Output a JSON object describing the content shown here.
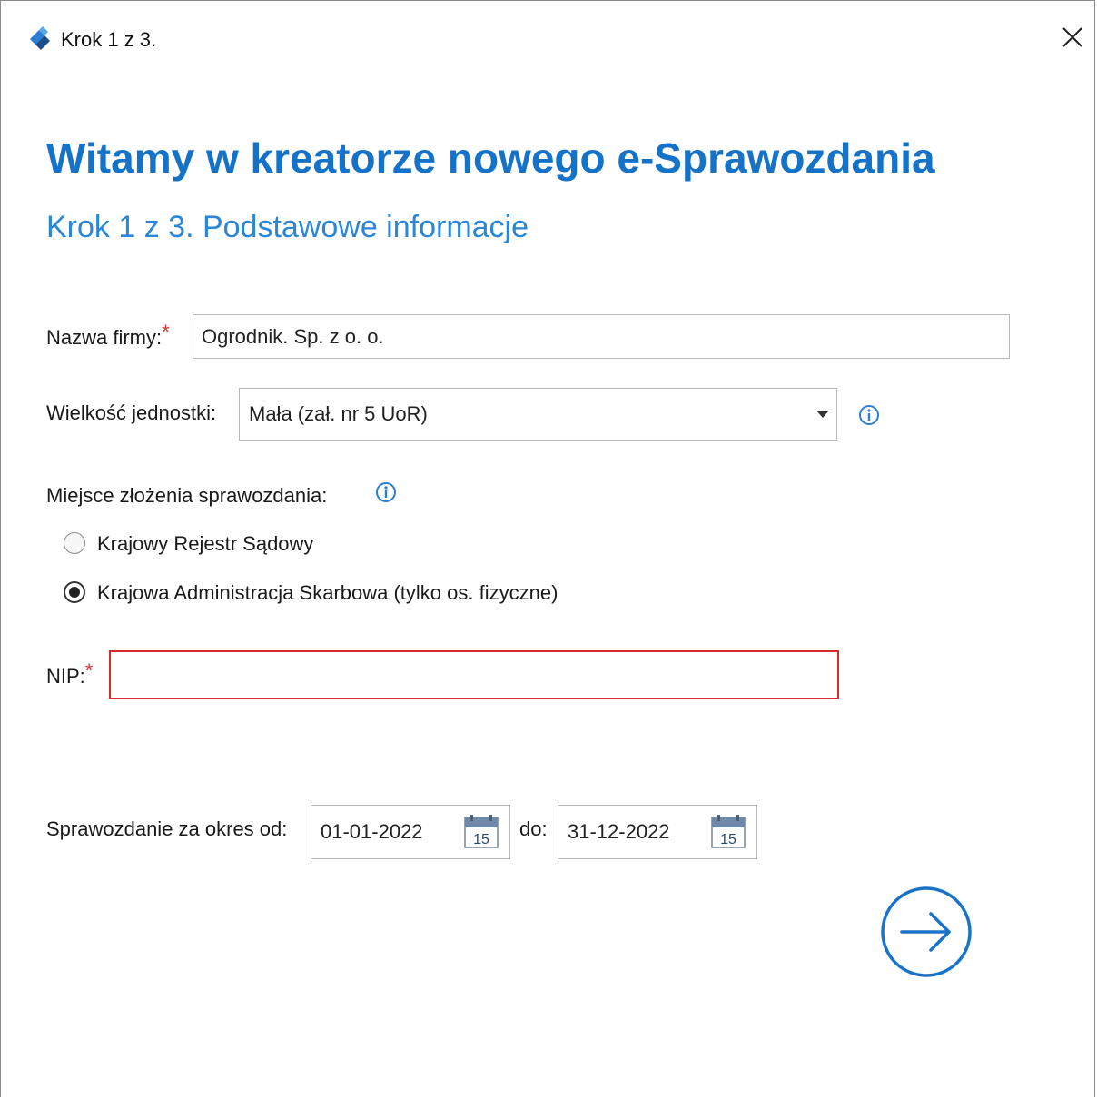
{
  "window": {
    "title": "Krok 1 z 3."
  },
  "header": {
    "title": "Witamy w kreatorze nowego e-Sprawozdania",
    "subtitle": "Krok 1 z 3. Podstawowe informacje"
  },
  "form": {
    "company_name_label": "Nazwa firmy:",
    "company_name_value": "Ogrodnik. Sp. z o. o.",
    "unit_size_label": "Wielkość jednostki:",
    "unit_size_value": "Mała (zał. nr 5 UoR)",
    "filing_place_label": "Miejsce złożenia sprawozdania:",
    "filing_options": [
      {
        "label": "Krajowy Rejestr Sądowy",
        "checked": false
      },
      {
        "label": "Krajowa Administracja Skarbowa (tylko os. fizyczne)",
        "checked": true
      }
    ],
    "nip_label": "NIP:",
    "nip_value": "",
    "required_marker": "*",
    "period_from_label": "Sprawozdanie za okres od:",
    "period_from_value": "01-01-2022",
    "period_to_label": "do:",
    "period_to_value": "31-12-2022",
    "calendar_day": "15"
  },
  "colors": {
    "accent": "#1473c8",
    "error_border": "#d42a2a",
    "required": "#e03030"
  }
}
